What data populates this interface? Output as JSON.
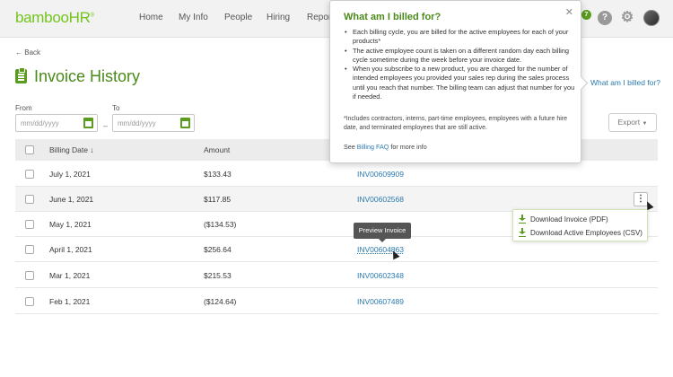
{
  "brand": {
    "logo_text": "bambooHR",
    "logo_mark": "®",
    "accent": "#73c41d",
    "title_color": "#4a8a1a",
    "link_color": "#2a7ab0"
  },
  "nav": {
    "items": [
      "Home",
      "My Info",
      "People",
      "Hiring",
      "Repor"
    ],
    "badge_count": "7"
  },
  "back_label": "Back",
  "page_title": "Invoice History",
  "billed_link": "What am I billed for?",
  "filters": {
    "from_label": "From",
    "to_label": "To",
    "from_placeholder": "mm/dd/yyyy",
    "to_placeholder": "mm/dd/yyyy",
    "separator": "–"
  },
  "export_label": "Export",
  "table": {
    "headers": {
      "date": "Billing Date",
      "sort_icon": "↓",
      "amount": "Amount"
    },
    "rows": [
      {
        "date": "July 1, 2021",
        "amount": "$133.43",
        "invoice": "INV00609909"
      },
      {
        "date": "June 1, 2021",
        "amount": "$117.85",
        "invoice": "INV00602568"
      },
      {
        "date": "May 1, 2021",
        "amount": "($134.53)",
        "invoice": ""
      },
      {
        "date": "April 1, 2021",
        "amount": "$256.64",
        "invoice": "INV00604863"
      },
      {
        "date": "Mar 1, 2021",
        "amount": "$215.53",
        "invoice": "INV00602348"
      },
      {
        "date": "Feb 1, 2021",
        "amount": "($124.64)",
        "invoice": "INV00607489"
      }
    ]
  },
  "row_menu": {
    "kebab": "⋮",
    "download_invoice": "Download Invoice (PDF)",
    "download_employees": "Download Active Employees (CSV)"
  },
  "tooltip": "Preview Invoice",
  "popover": {
    "title": "What am I billed for?",
    "close": "✕",
    "bullets": [
      "Each billing cycle, you are billed for the active employees for each of your products*",
      "The active employee count is taken on a different random day each billing cycle sometime during the week before your invoice date.",
      "When you subscribe to a new product, you are charged for the number of intended employees you provided your sales rep during the sales process until you reach that number. The billing team can adjust that number for you if needed."
    ],
    "note": "*Includes contractors, interns, part-time employees, employees with a future hire date, and terminated employees that are still active.",
    "faq_prefix": "See",
    "faq_link": "Billing FAQ",
    "faq_suffix": "for more info"
  }
}
